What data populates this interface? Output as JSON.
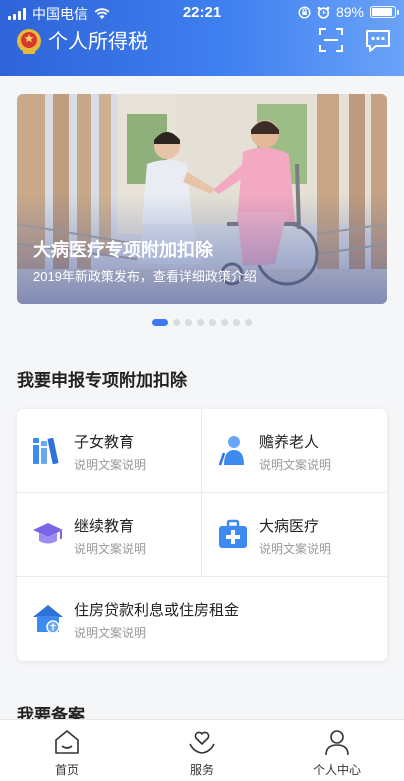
{
  "status_bar": {
    "carrier": "中国电信",
    "time": "22:21",
    "battery": "89%",
    "battery_level": 0.89
  },
  "header": {
    "title": "个人所得税"
  },
  "banner": {
    "title": "大病医疗专项附加扣除",
    "subtitle": "2019年新政策发布，查看详细政策介绍",
    "slide_count": 8,
    "active_index": 0
  },
  "deductions": {
    "heading": "我要申报专项附加扣除",
    "items": [
      {
        "title": "子女教育",
        "desc": "说明文案说明",
        "icon": "books-icon"
      },
      {
        "title": "赡养老人",
        "desc": "说明文案说明",
        "icon": "elder-icon"
      },
      {
        "title": "继续教育",
        "desc": "说明文案说明",
        "icon": "graduation-cap-icon"
      },
      {
        "title": "大病医疗",
        "desc": "说明文案说明",
        "icon": "medical-kit-icon"
      },
      {
        "title": "住房贷款利息或住房租金",
        "desc": "说明文案说明",
        "icon": "house-icon"
      }
    ]
  },
  "filing": {
    "heading": "我要备案"
  },
  "tabbar": {
    "items": [
      {
        "label": "首页",
        "icon": "home-icon"
      },
      {
        "label": "服务",
        "icon": "heart-hands-icon"
      },
      {
        "label": "个人中心",
        "icon": "user-icon"
      }
    ]
  },
  "colors": {
    "accent": "#3a7af0",
    "header_start": "#2e64d8",
    "header_end": "#6aa3f8",
    "icon_blue": "#3d8bf0"
  }
}
